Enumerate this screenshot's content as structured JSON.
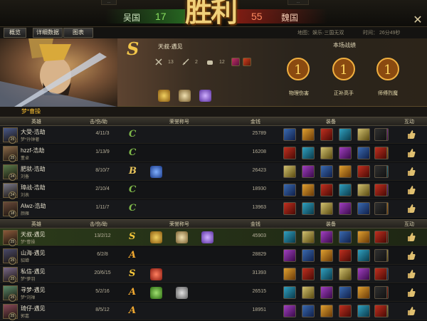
{
  "header": {
    "left_team": "吴国",
    "left_score": "17",
    "right_team": "魏国",
    "right_score": "55",
    "result": "胜利"
  },
  "tabs": [
    "概览",
    "详细数据",
    "图表"
  ],
  "map_label": "地图：娱乐·三国无双",
  "time_label": "时间：  26分49秒",
  "hero": {
    "rank": "S",
    "name": "天叔-遇见",
    "stats": [
      "13",
      "2",
      "12"
    ]
  },
  "battle_title": "本场战绩",
  "medals": [
    "物理伤害",
    "正补高手",
    "师傅烈魔"
  ],
  "player_section_label": "梦*曹操",
  "columns": {
    "hero": "英雄",
    "kda": "击/伤/助",
    "honor": "荣誉称号",
    "money": "金钱",
    "equip": "装备",
    "interact": "互动"
  },
  "team1": [
    {
      "name": "大受-浩劫",
      "level": "25",
      "general": "梦*孙钟奢",
      "kda": "4/11/3",
      "grade": "C",
      "money": "25789",
      "honors": []
    },
    {
      "name": "hzzf-浩劫",
      "level": "25",
      "general": "董卓",
      "kda": "1/13/9",
      "grade": "C",
      "money": "16208",
      "honors": []
    },
    {
      "name": "肥就-浩劫",
      "level": "24",
      "general": "刘备",
      "kda": "8/10/7",
      "grade": "B",
      "money": "26423",
      "honors": [
        "blue"
      ]
    },
    {
      "name": "璋战-浩劫",
      "level": "24",
      "general": "刘表",
      "kda": "2/10/4",
      "grade": "C",
      "money": "18930",
      "honors": []
    },
    {
      "name": "Alwz-浩劫",
      "level": "18",
      "general": "颜雁",
      "kda": "1/11/7",
      "grade": "C",
      "money": "13963",
      "honors": []
    }
  ],
  "team2": [
    {
      "name": "天叔-遇见",
      "level": "25",
      "general": "梦*曹操",
      "kda": "13/2/12",
      "grade": "S",
      "money": "45903",
      "honors": [
        "gold",
        "wine",
        "purple"
      ]
    },
    {
      "name": "山海-遇见",
      "level": "25",
      "general": "貂蝉",
      "kda": "6/2/8",
      "grade": "A",
      "money": "28829",
      "honors": []
    },
    {
      "name": "私信-遇见",
      "level": "25",
      "general": "梦*夢羽",
      "kda": "20/6/15",
      "grade": "S",
      "money": "31393",
      "honors": [
        "red"
      ]
    },
    {
      "name": "寻梦-遇见",
      "level": "25",
      "general": "梦*刘禅",
      "kda": "5/2/16",
      "grade": "A",
      "money": "26515",
      "honors": [
        "green",
        "grey"
      ]
    },
    {
      "name": "琦仔-遇见",
      "level": "25",
      "general": "郭嘉",
      "kda": "8/5/12",
      "grade": "A",
      "money": "18951",
      "honors": []
    }
  ],
  "colors": {
    "grade_S": "#f3c53a",
    "grade_A": "#f0a830",
    "grade_B": "#e6c25a",
    "grade_C": "#7fb84a",
    "gold_text": "#f0b830"
  }
}
